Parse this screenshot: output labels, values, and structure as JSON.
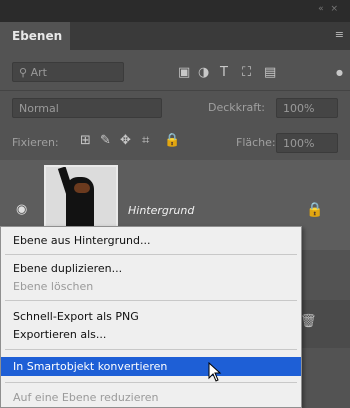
{
  "panel": {
    "tab_label": "Ebenen",
    "panel_menu_icon": "panel-menu-icon",
    "filter_kind_value": "Art",
    "blend_mode_value": "Normal",
    "opacity_label": "Deckkraft:",
    "opacity_value": "100%",
    "lock_label": "Fixieren:",
    "fill_label": "Fläche:",
    "fill_value": "100%"
  },
  "layer": {
    "name": "Hintergrund"
  },
  "context_menu": {
    "items": [
      {
        "label": "Ebene aus Hintergrund...",
        "enabled": true
      },
      {
        "label": "Ebene duplizieren...",
        "enabled": true
      },
      {
        "label": "Ebene löschen",
        "enabled": false
      },
      {
        "label": "Schnell-Export als PNG",
        "enabled": true
      },
      {
        "label": "Exportieren als...",
        "enabled": true
      },
      {
        "label": "In Smartobjekt konvertieren",
        "enabled": true,
        "highlighted": true
      },
      {
        "label": "Auf eine Ebene reduzieren",
        "enabled": false
      }
    ]
  },
  "colors": {
    "panel_bg": "#535353",
    "menu_bg": "#efefef",
    "highlight": "#1e5fd6"
  }
}
